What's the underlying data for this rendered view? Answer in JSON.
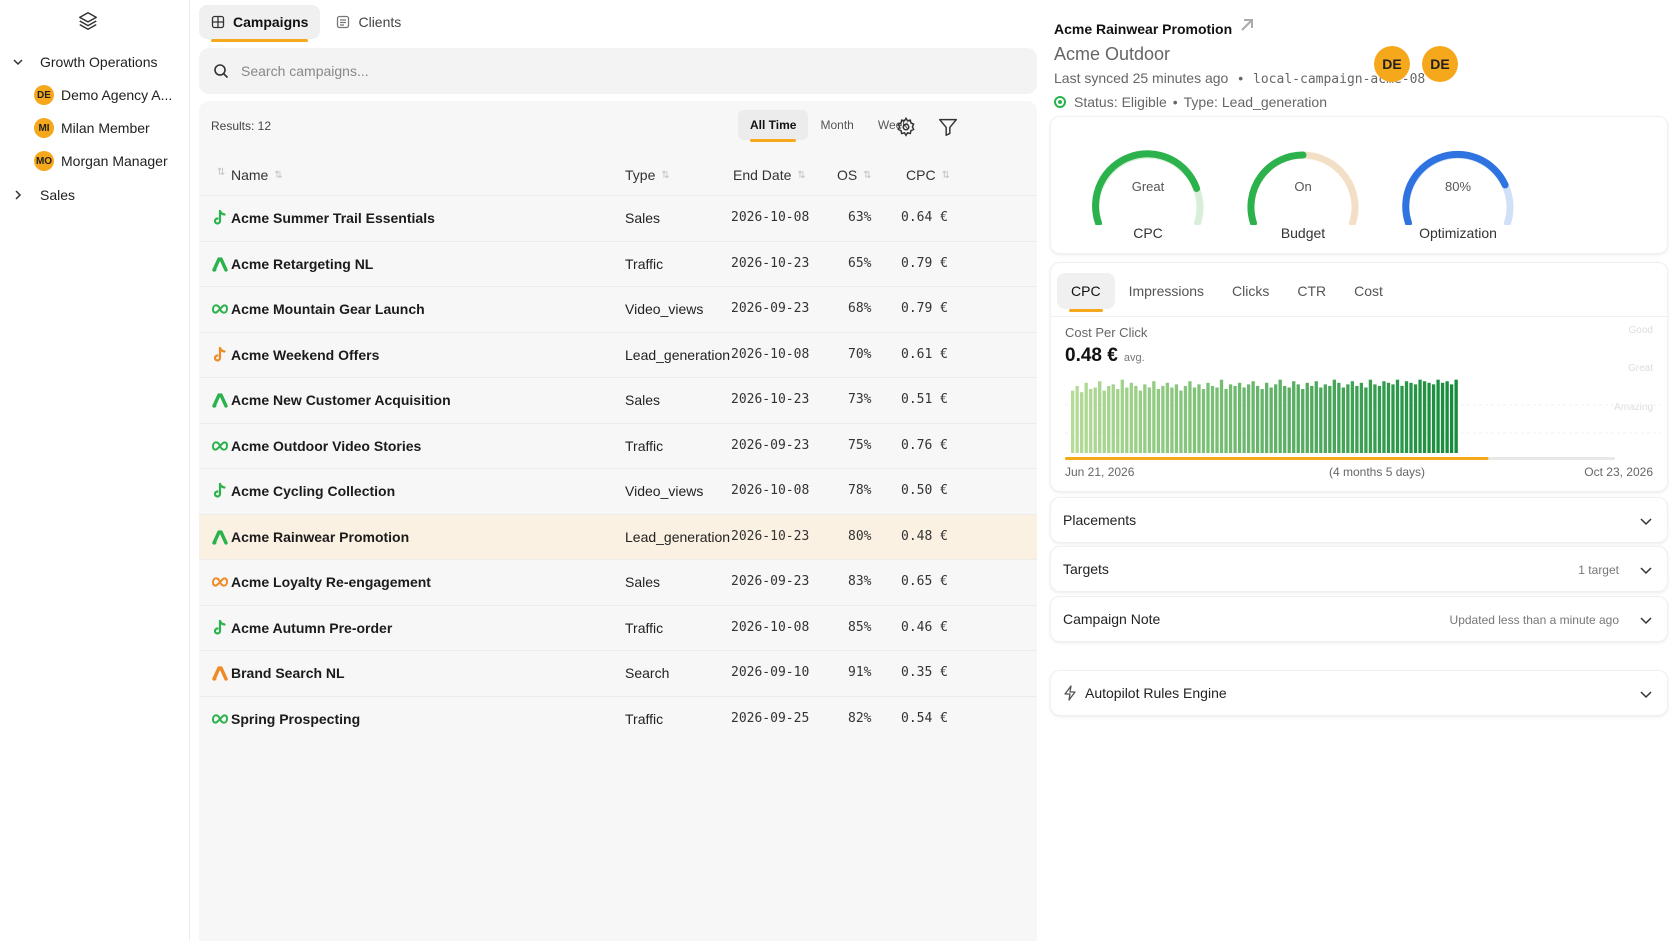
{
  "sidebar": {
    "groups": [
      {
        "label": "Growth Operations",
        "expanded": true
      },
      {
        "label": "Sales",
        "expanded": false
      }
    ],
    "members": [
      {
        "initials": "DE",
        "name": "Demo Agency A..."
      },
      {
        "initials": "MI",
        "name": "Milan Member"
      },
      {
        "initials": "MO",
        "name": "Morgan Manager"
      }
    ]
  },
  "tabs": [
    {
      "label": "Campaigns",
      "active": true
    },
    {
      "label": "Clients",
      "active": false
    }
  ],
  "search": {
    "placeholder": "Search campaigns..."
  },
  "toolbar": {
    "results": "Results: 12",
    "ranges": [
      "All Time",
      "Month",
      "Week"
    ],
    "active_range": "All Time"
  },
  "table": {
    "headers": [
      "Name",
      "Type",
      "End Date",
      "OS",
      "CPC"
    ],
    "rows": [
      {
        "platform": "tiktok",
        "color": "#2bb24c",
        "name": "Acme Summer Trail Essentials",
        "type": "Sales",
        "end": "2026-10-08",
        "os": "63%",
        "cpc": "0.64 €"
      },
      {
        "platform": "google-ads",
        "color": "#2bb24c",
        "name": "Acme Retargeting NL",
        "type": "Traffic",
        "end": "2026-10-23",
        "os": "65%",
        "cpc": "0.79 €"
      },
      {
        "platform": "meta",
        "color": "#2bb24c",
        "name": "Acme Mountain Gear Launch",
        "type": "Video_views",
        "end": "2026-09-23",
        "os": "68%",
        "cpc": "0.79 €"
      },
      {
        "platform": "tiktok",
        "color": "#f08a24",
        "name": "Acme Weekend Offers",
        "type": "Lead_generation",
        "end": "2026-10-08",
        "os": "70%",
        "cpc": "0.61 €"
      },
      {
        "platform": "google-ads",
        "color": "#2bb24c",
        "name": "Acme New Customer Acquisition",
        "type": "Sales",
        "end": "2026-10-23",
        "os": "73%",
        "cpc": "0.51 €"
      },
      {
        "platform": "meta",
        "color": "#2bb24c",
        "name": "Acme Outdoor Video Stories",
        "type": "Traffic",
        "end": "2026-09-23",
        "os": "75%",
        "cpc": "0.76 €"
      },
      {
        "platform": "tiktok",
        "color": "#2bb24c",
        "name": "Acme Cycling Collection",
        "type": "Video_views",
        "end": "2026-10-08",
        "os": "78%",
        "cpc": "0.50 €"
      },
      {
        "platform": "google-ads",
        "color": "#2bb24c",
        "name": "Acme Rainwear Promotion",
        "type": "Lead_generation",
        "end": "2026-10-23",
        "os": "80%",
        "cpc": "0.48 €",
        "selected": true
      },
      {
        "platform": "meta",
        "color": "#f08a24",
        "name": "Acme Loyalty Re-engagement",
        "type": "Sales",
        "end": "2026-09-23",
        "os": "83%",
        "cpc": "0.65 €"
      },
      {
        "platform": "tiktok",
        "color": "#2bb24c",
        "name": "Acme Autumn Pre-order",
        "type": "Traffic",
        "end": "2026-10-08",
        "os": "85%",
        "cpc": "0.46 €"
      },
      {
        "platform": "google-ads",
        "color": "#f08a24",
        "name": "Brand Search NL",
        "type": "Search",
        "end": "2026-09-10",
        "os": "91%",
        "cpc": "0.35 €"
      },
      {
        "platform": "meta",
        "color": "#2bb24c",
        "name": "Spring Prospecting",
        "type": "Traffic",
        "end": "2026-09-25",
        "os": "82%",
        "cpc": "0.54 €"
      }
    ]
  },
  "detail": {
    "title": "Acme Rainwear Promotion",
    "client": "Acme Outdoor",
    "synced": "Last synced 25 minutes ago",
    "campaign_id": "local-campaign-acme-08",
    "status_label": "Status:",
    "status_value": "Eligible",
    "type_label": "Type:",
    "type_value": "Lead_generation",
    "avatars": [
      "DE",
      "DE"
    ],
    "gauges": [
      {
        "value": "Great",
        "label": "CPC",
        "fill": 0.82,
        "color": "#2bb24c",
        "track": "#d7efd9"
      },
      {
        "value": "On",
        "label": "Budget",
        "fill": 0.5,
        "color": "#2bb24c",
        "track": "#f3dfc6"
      },
      {
        "value": "80%",
        "label": "Optimization",
        "fill": 0.8,
        "color": "#2f73e0",
        "track": "#cfe0f7"
      }
    ],
    "metric_tabs": [
      "CPC",
      "Impressions",
      "Clicks",
      "CTR",
      "Cost"
    ],
    "active_metric": "CPC",
    "metric_title": "Cost Per Click",
    "metric_value": "0.48 €",
    "metric_unit": "avg.",
    "bands": [
      "Good",
      "Great",
      "Amazing"
    ],
    "date_start": "Jun 21, 2026",
    "date_span": "(4 months 5 days)",
    "date_end": "Oct 23, 2026",
    "progress": 0.77,
    "sections": [
      {
        "title": "Placements",
        "meta": ""
      },
      {
        "title": "Targets",
        "meta": "1 target"
      },
      {
        "title": "Campaign Note",
        "meta": "Updated less than a minute ago"
      }
    ],
    "autopilot": "Autopilot Rules Engine"
  },
  "chart_data": {
    "type": "bar",
    "title": "Cost Per Click",
    "xlabel": "",
    "ylabel": "",
    "x_range": [
      "Jun 21, 2026",
      "Oct 23, 2026"
    ],
    "values": [
      0.4,
      0.43,
      0.39,
      0.45,
      0.41,
      0.42,
      0.46,
      0.4,
      0.43,
      0.44,
      0.41,
      0.47,
      0.42,
      0.45,
      0.43,
      0.4,
      0.44,
      0.42,
      0.46,
      0.41,
      0.43,
      0.45,
      0.42,
      0.44,
      0.4,
      0.43,
      0.46,
      0.42,
      0.44,
      0.41,
      0.45,
      0.43,
      0.42,
      0.47,
      0.41,
      0.44,
      0.43,
      0.45,
      0.42,
      0.44,
      0.46,
      0.43,
      0.41,
      0.45,
      0.42,
      0.44,
      0.47,
      0.43,
      0.42,
      0.46,
      0.44,
      0.41,
      0.45,
      0.43,
      0.46,
      0.42,
      0.44,
      0.43,
      0.47,
      0.45,
      0.42,
      0.44,
      0.46,
      0.43,
      0.45,
      0.42,
      0.47,
      0.44,
      0.43,
      0.46,
      0.45,
      0.44,
      0.47,
      0.43,
      0.46,
      0.45,
      0.44,
      0.47,
      0.46,
      0.45,
      0.44,
      0.47,
      0.45,
      0.46,
      0.44,
      0.47
    ]
  }
}
